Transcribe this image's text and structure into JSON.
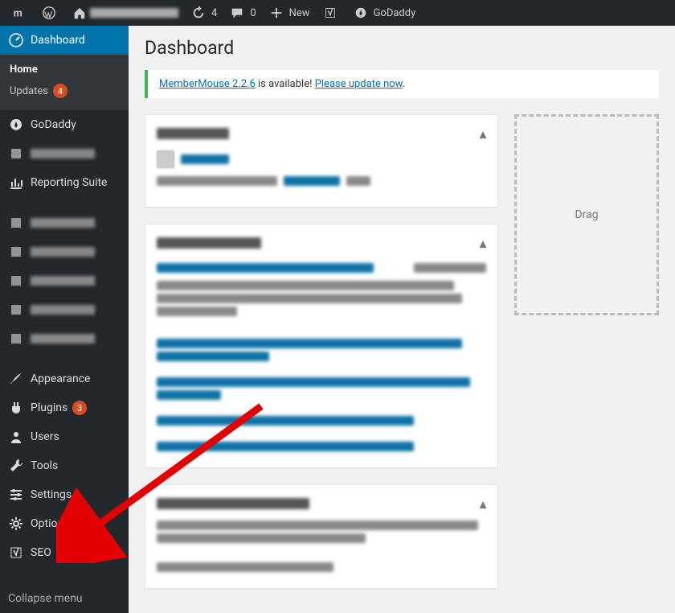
{
  "adminbar": {
    "items": [
      {
        "name": "m-menu-icon",
        "icon": "m",
        "label": "",
        "interactable": true
      },
      {
        "name": "wordpress-icon",
        "icon": "wp",
        "label": "",
        "interactable": true
      },
      {
        "name": "site-home",
        "icon": "home",
        "label": "",
        "blurred": true,
        "interactable": true
      },
      {
        "name": "updates-item",
        "icon": "refresh",
        "label": "4",
        "interactable": true
      },
      {
        "name": "comments-item",
        "icon": "comment",
        "label": "0",
        "interactable": true
      },
      {
        "name": "new-item",
        "icon": "plus",
        "label": "New",
        "interactable": true
      },
      {
        "name": "yoast-item",
        "icon": "yoast",
        "label": "",
        "interactable": true
      },
      {
        "name": "godaddy-item",
        "icon": "godaddy",
        "label": "GoDaddy",
        "interactable": true
      }
    ]
  },
  "sidebar": {
    "items": [
      {
        "key": "dashboard",
        "label": "Dashboard",
        "icon": "dashboard",
        "active": true,
        "submenu": [
          {
            "key": "home",
            "label": "Home",
            "current": true,
            "badge": null
          },
          {
            "key": "updates",
            "label": "Updates",
            "current": false,
            "badge": "4"
          }
        ]
      },
      {
        "key": "godaddy",
        "label": "GoDaddy",
        "icon": "godaddy"
      },
      {
        "key": "membermouse",
        "label": "",
        "icon": "generic",
        "blurred": true
      },
      {
        "key": "reporting",
        "label": "Reporting Suite",
        "icon": "chart"
      },
      {
        "key": "media",
        "label": "",
        "icon": "generic",
        "blurred": true
      },
      {
        "key": "pages",
        "label": "",
        "icon": "generic",
        "blurred": true
      },
      {
        "key": "modules",
        "label": "",
        "icon": "generic",
        "blurred": true
      },
      {
        "key": "bonuses",
        "label": "",
        "icon": "generic",
        "blurred": true
      },
      {
        "key": "downloads",
        "label": "",
        "icon": "generic",
        "blurred": true
      },
      {
        "key": "appearance",
        "label": "Appearance",
        "icon": "brush"
      },
      {
        "key": "plugins",
        "label": "Plugins",
        "icon": "plugin",
        "badge": "3"
      },
      {
        "key": "users",
        "label": "Users",
        "icon": "user"
      },
      {
        "key": "tools",
        "label": "Tools",
        "icon": "wrench"
      },
      {
        "key": "settings",
        "label": "Settings",
        "icon": "sliders"
      },
      {
        "key": "options",
        "label": "Options",
        "icon": "gear"
      },
      {
        "key": "seo",
        "label": "SEO",
        "icon": "yoast"
      }
    ],
    "collapse_label": "Collapse menu"
  },
  "page": {
    "title": "Dashboard"
  },
  "notice": {
    "link1": "MemberMouse 2.2.6",
    "mid": " is available! ",
    "link2": "Please update now",
    "end": "."
  },
  "dropzone": {
    "text": "Drag"
  }
}
